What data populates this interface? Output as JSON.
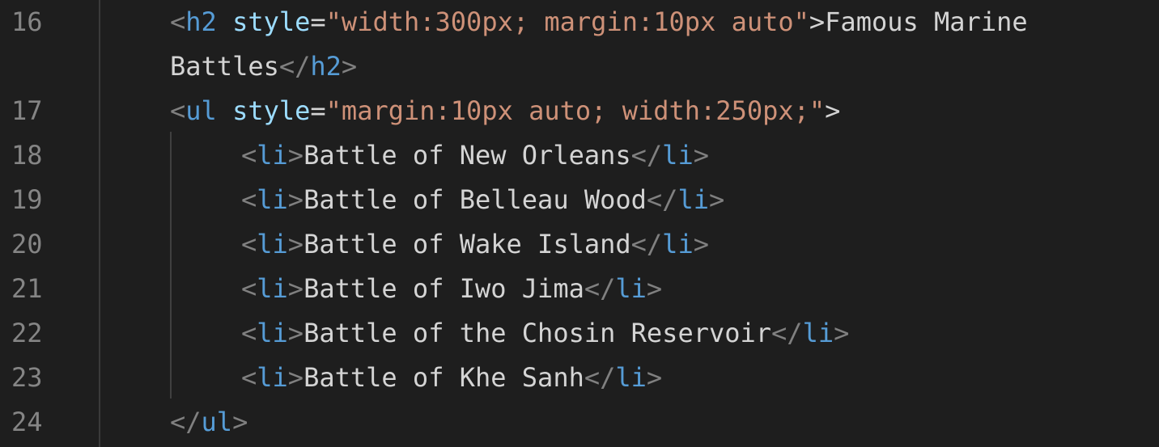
{
  "editor": {
    "line_numbers": [
      "16",
      "",
      "17",
      "18",
      "19",
      "20",
      "21",
      "22",
      "23",
      "24"
    ],
    "lines": [
      {
        "tokens": [
          "<",
          "h2",
          " ",
          "style",
          "=",
          "\"width:300px; margin:10px auto\"",
          ">",
          "Famous Marine"
        ]
      },
      {
        "tokens": [
          "Battles",
          "</",
          "h2",
          ">"
        ]
      },
      {
        "tokens": [
          "<",
          "ul",
          " ",
          "style",
          "=",
          "\"margin:10px auto; width:250px;\"",
          ">"
        ]
      },
      {
        "tokens": [
          "<",
          "li",
          ">",
          "Battle of New Orleans",
          "</",
          "li",
          ">"
        ]
      },
      {
        "tokens": [
          "<",
          "li",
          ">",
          "Battle of Belleau Wood",
          "</",
          "li",
          ">"
        ]
      },
      {
        "tokens": [
          "<",
          "li",
          ">",
          "Battle of Wake Island",
          "</",
          "li",
          ">"
        ]
      },
      {
        "tokens": [
          "<",
          "li",
          ">",
          "Battle of Iwo Jima",
          "</",
          "li",
          ">"
        ]
      },
      {
        "tokens": [
          "<",
          "li",
          ">",
          "Battle of the Chosin Reservoir",
          "</",
          "li",
          ">"
        ]
      },
      {
        "tokens": [
          "<",
          "li",
          ">",
          "Battle of Khe Sanh",
          "</",
          "li",
          ">"
        ]
      },
      {
        "tokens": [
          "</",
          "ul",
          ">"
        ]
      }
    ]
  },
  "colors": {
    "background": "#1e1e1e",
    "line_number": "#858585",
    "punctuation": "#808080",
    "tag": "#569cd6",
    "attribute": "#9cdcfe",
    "string": "#ce9178",
    "text": "#d4d4d4"
  }
}
